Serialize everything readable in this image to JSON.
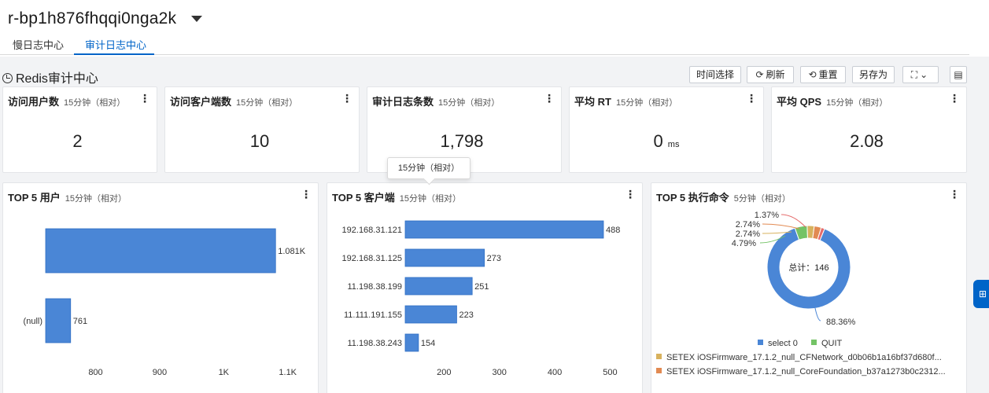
{
  "header": {
    "instance": "r-bp1h876fhqqi0nga2k",
    "tabs": [
      {
        "label": "慢日志中心"
      },
      {
        "label": "审计日志中心",
        "active": true
      }
    ]
  },
  "section": {
    "title": "Redis审计中心",
    "toolbar": {
      "time": "时间选择",
      "refresh": "刷新",
      "reset": "重置",
      "saveas": "另存为"
    }
  },
  "kpis": [
    {
      "title": "访问用户数",
      "sub": "15分钟（相对）",
      "value": "2",
      "unit": ""
    },
    {
      "title": "访问客户端数",
      "sub": "15分钟（相对）",
      "value": "10",
      "unit": ""
    },
    {
      "title": "审计日志条数",
      "sub": "15分钟（相对）",
      "value": "1,798",
      "unit": ""
    },
    {
      "title": "平均 RT",
      "sub": "15分钟（相对）",
      "value": "0",
      "unit": "ms"
    },
    {
      "title": "平均 QPS",
      "sub": "15分钟（相对）",
      "value": "2.08",
      "unit": ""
    }
  ],
  "tooltip": "15分钟（相对）",
  "panels": {
    "users": {
      "title": "TOP 5 用户",
      "sub": "15分钟（相对）"
    },
    "clients": {
      "title": "TOP 5 客户端",
      "sub": "15分钟（相对）"
    },
    "commands": {
      "title": "TOP 5 执行命令",
      "sub": "5分钟（相对）"
    }
  },
  "chart_data": [
    {
      "type": "bar",
      "orientation": "horizontal",
      "categories": [
        "",
        "(null)"
      ],
      "values": [
        1081,
        761
      ],
      "value_labels": [
        "1.081K",
        "761"
      ],
      "xticks": [
        800,
        900,
        1000,
        1100
      ],
      "xtick_labels": [
        "800",
        "900",
        "1K",
        "1.1K"
      ],
      "xlim": [
        722,
        1120
      ]
    },
    {
      "type": "bar",
      "orientation": "horizontal",
      "categories": [
        "192.168.31.121",
        "192.168.31.125",
        "11.198.38.199",
        "11.111.191.155",
        "11.198.38.243"
      ],
      "values": [
        488,
        273,
        251,
        223,
        154
      ],
      "value_labels": [
        "488",
        "273",
        "251",
        "223",
        "154"
      ],
      "xticks": [
        200,
        300,
        400,
        500
      ],
      "xtick_labels": [
        "200",
        "300",
        "400",
        "500"
      ],
      "xlim": [
        130,
        515
      ]
    },
    {
      "type": "pie",
      "donut": true,
      "center_label": "总计：146",
      "slices": [
        {
          "name": "select 0",
          "value": 88.36,
          "label": "88.36%",
          "color": "#4a86d6"
        },
        {
          "name": "QUIT",
          "value": 4.79,
          "label": "4.79%",
          "color": "#74c366"
        },
        {
          "name": "SETEX iOSFirmware_17.1.2_null_CFNetwork_d0b06b1a16bf37d680f...",
          "value": 2.74,
          "label": "2.74%",
          "color": "#d8b25e"
        },
        {
          "name": "SETEX iOSFirmware_17.1.2_null_CoreFoundation_b37a1273b0c2312...",
          "value": 2.74,
          "label": "2.74%",
          "color": "#e28a52"
        },
        {
          "name": "",
          "value": 1.37,
          "label": "1.37%",
          "color": "#e56b6b"
        }
      ]
    }
  ],
  "colors": {
    "bar": "#4a86d6",
    "accent": "#0064c8"
  }
}
